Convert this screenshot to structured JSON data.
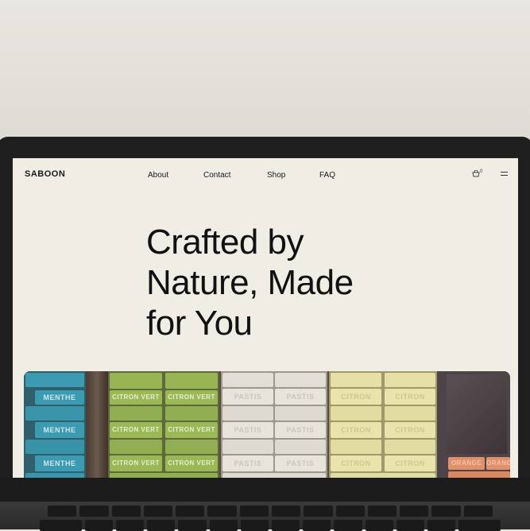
{
  "site": {
    "logo": "SABOON",
    "nav": [
      "About",
      "Contact",
      "Shop",
      "FAQ"
    ],
    "cart_count": "0"
  },
  "hero": {
    "line1": "Crafted by",
    "line2": "Nature, Made",
    "line3": "for You"
  },
  "image": {
    "soap_labels": [
      "MENTHE",
      "CITRON VERT",
      "PASTIS",
      "CITRON",
      "ORANGE"
    ]
  }
}
